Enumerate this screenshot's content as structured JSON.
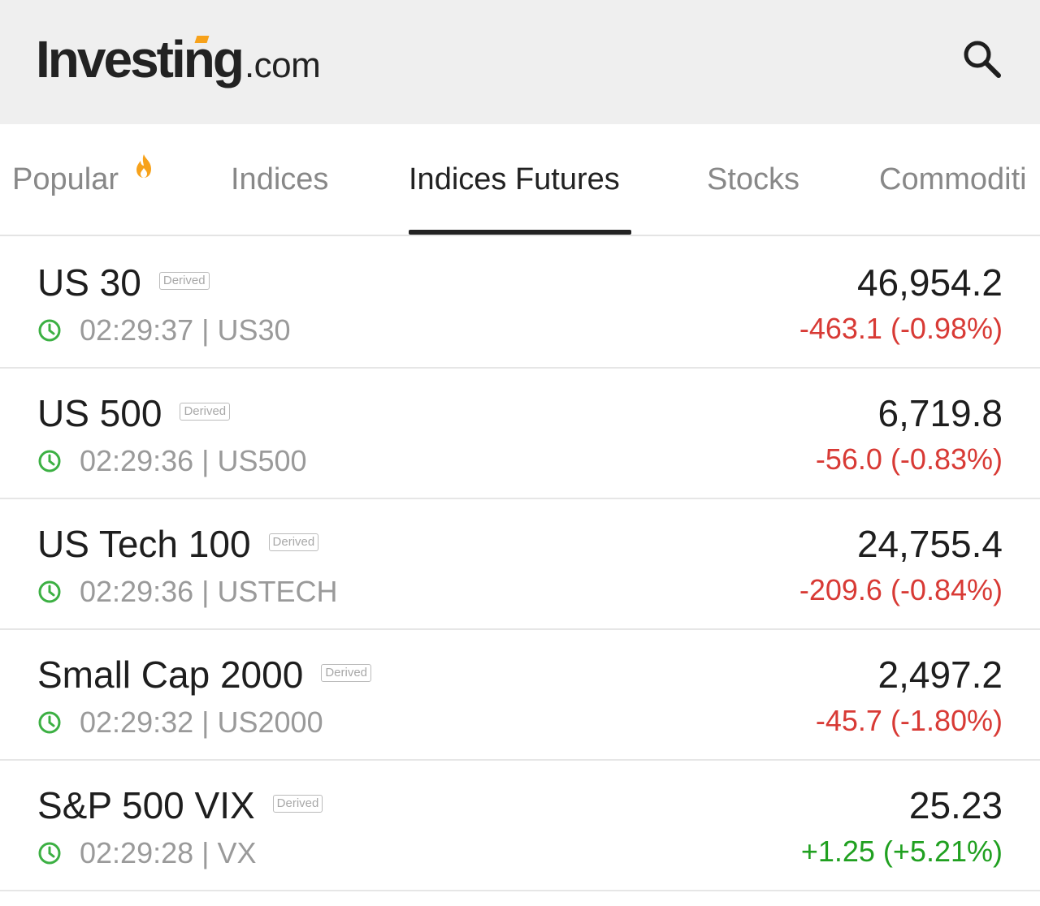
{
  "app": {
    "logo_main": "Investing",
    "logo_suffix": ".com"
  },
  "header": {
    "search_icon": "search-icon"
  },
  "tabs": [
    {
      "label": "Popular",
      "icon": "fire-icon"
    },
    {
      "label": "Indices"
    },
    {
      "label": "Indices Futures",
      "active": true
    },
    {
      "label": "Stocks"
    },
    {
      "label": "Commoditi"
    }
  ],
  "colors": {
    "negative": "#d83a35",
    "positive": "#20a020",
    "accent": "#f7a21b",
    "clock": "#3cb043"
  },
  "rows": [
    {
      "name": "US 30",
      "badge": "Derived",
      "meta": "02:29:37 | US30",
      "price": "46,954.2",
      "change": "-463.1 (-0.98%)",
      "direction": "neg"
    },
    {
      "name": "US 500",
      "badge": "Derived",
      "meta": "02:29:36 | US500",
      "price": "6,719.8",
      "change": "-56.0 (-0.83%)",
      "direction": "neg"
    },
    {
      "name": "US Tech 100",
      "badge": "Derived",
      "meta": "02:29:36 | USTECH",
      "price": "24,755.4",
      "change": "-209.6 (-0.84%)",
      "direction": "neg"
    },
    {
      "name": "Small Cap 2000",
      "badge": "Derived",
      "meta": "02:29:32 | US2000",
      "price": "2,497.2",
      "change": "-45.7 (-1.80%)",
      "direction": "neg"
    },
    {
      "name": "S&P 500 VIX",
      "badge": "Derived",
      "meta": "02:29:28 | VX",
      "price": "25.23",
      "change": "+1.25 (+5.21%)",
      "direction": "pos"
    }
  ]
}
